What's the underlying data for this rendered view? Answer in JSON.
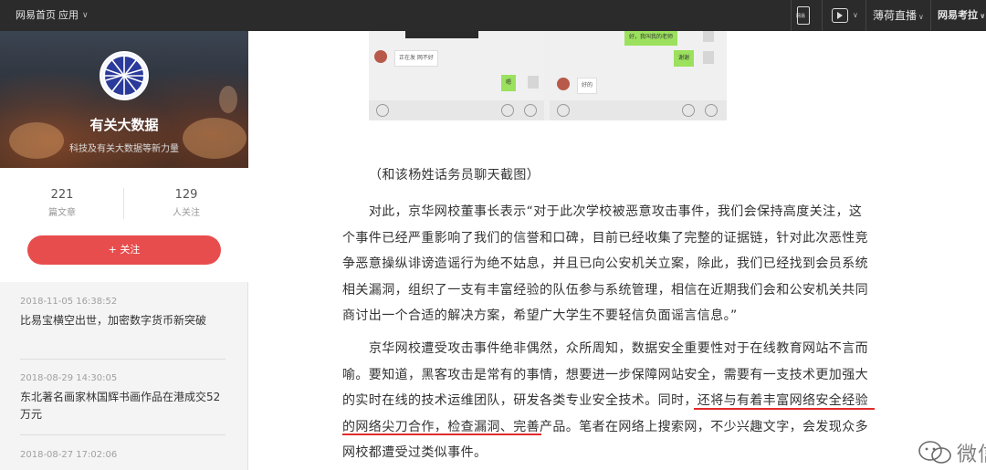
{
  "topbar": {
    "home": "网易首页",
    "apps": "应用",
    "phone_icon_label": "网易",
    "live": "薄荷直播",
    "exam": "网易考拉"
  },
  "profile": {
    "name": "有关大数据",
    "description": "科技及有关大数据等新力量",
    "articles_count": "221",
    "articles_label": "篇文章",
    "followers_count": "129",
    "followers_label": "人关注",
    "follow_button": "+ 关注"
  },
  "side_articles": [
    {
      "time": "2018-11-05 16:38:52",
      "title": "比易宝横空出世，加密数字货币新突破"
    },
    {
      "time": "2018-08-29 14:30:05",
      "title": "东北著名画家林国辉书画作品在港成交52万元"
    },
    {
      "time": "2018-08-27 17:02:06",
      "title": ""
    }
  ],
  "chat": {
    "msg1": "正在发 网不好",
    "msg2": "好的",
    "reply1": "嗯",
    "reply2": "谢谢",
    "reply3": "好，我叫我的老师"
  },
  "article": {
    "caption": "（和该杨姓话务员聊天截图）",
    "para1": "对此，京华网校董事长表示“对于此次学校被恶意攻击事件，我们会保持高度关注，这个事件已经严重影响了我们的信誉和口碑，目前已经收集了完整的证据链，针对此次恶性竞争恶意操纵诽谤造谣行为绝不姑息，并且已向公安机关立案，除此，我们已经找到会员系统相关漏洞，组织了一支有丰富经验的队伍参与系统管理，相信在近期我们会和公安机关共同商讨出一个合适的解决方案，希望广大学生不要轻信负面谣言信息。”",
    "para2": "京华网校遭受攻击事件绝非偶然，众所周知，数据安全重要性对于在线教育网站不言而喻。要知道，黑客攻击是常有的事情，想要进一步保障网站安全，需要有一支技术更加强大的实时在线的技术运维团队，研发各类专业安全技术。同时，还将与有着丰富网络安全经验的网络尖刀合作，检查漏洞、完善产品。笔者在网络上搜索网，不少兴趣文字，会发现众多网校都遭受过类似事件。"
  },
  "watermark": "微信号: mebang_com",
  "colors": {
    "accent": "#e84d4d",
    "topbar": "#2b2b2b",
    "underline": "#e12b2b"
  }
}
